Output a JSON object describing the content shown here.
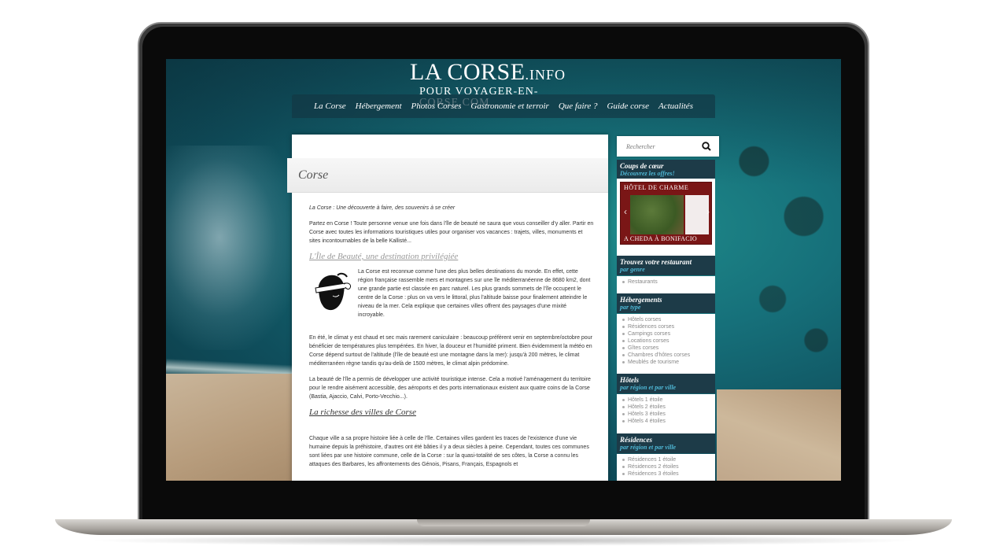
{
  "site": {
    "logo_title": "LA CORSE",
    "logo_suffix": ".INFO",
    "logo_subtitle": "POUR VOYAGER-EN-CORSE.COM"
  },
  "nav": {
    "items": [
      "La Corse",
      "Hébergement",
      "Photos Corses",
      "Gastronomie et terroir",
      "Que faire ?",
      "Guide corse",
      "Actualités"
    ]
  },
  "page": {
    "title": "Corse",
    "tagline": "La Corse : Une découverte à faire, des souvenirs à se créer",
    "intro": "Partez en Corse ! Toute personne venue une fois dans l'île de beauté ne saura que vous conseiller d'y aller. Partir en Corse avec toutes les informations touristiques utiles pour organiser vos vacances : trajets, villes, monuments et sites incontournables de la belle Kallisté...",
    "section1_heading": "L'Île de Beauté, une destination privilégiée",
    "section1_p1": "La Corse est reconnue comme l'une des plus belles destinations du monde. En effet, cette région française rassemble mers et montagnes sur une île méditerranéenne de 8680 km2, dont une grande partie est classée en parc naturel. Les plus grands sommets de l'île occupent le centre de la Corse : plus on va vers le littoral, plus l'altitude baisse pour finalement atteindre le niveau de la mer. Cela explique que certaines villes offrent des paysages d'une mixité incroyable.",
    "section1_p2": "En été, le climat y est chaud et sec mais rarement caniculaire : beaucoup préfèrent venir en septembre/octobre pour bénéficier de températures plus tempérées. En hiver, la douceur et l'humidité priment. Bien évidemment la météo en Corse dépend surtout de l'altitude (l'île de beauté est une montagne dans la mer): jusqu'à 200 mètres, le climat méditerranéen règne tandis qu'au-delà de 1500 mètres, le climat alpin prédomine.",
    "section1_p3": "La beauté de l'île a permis de développer une activité touristique intense. Cela a motivé l'aménagement du territoire pour le rendre aisément accessible, des aéroports et des ports internationaux existent aux quatre coins de la Corse (Bastia, Ajaccio, Calvi, Porto-Vecchio...).",
    "section2_heading": "La richesse des villes de Corse",
    "section2_p1": "Chaque ville a sa propre histoire liée à celle de l'île. Certaines villes gardent les traces de l'existence d'une vie humaine depuis la préhistoire, d'autres ont été bâties il y a deux siècles à peine. Cependant, toutes ces communes sont liées par une histoire commune, celle de la Corse : sur la quasi-totalité de ses côtes, la Corse a connu les attaques des Barbares, les affrontements des Génois, Pisans, Français, Espagnols et"
  },
  "sidebar": {
    "search_placeholder": "Rechercher",
    "coups_title": "Coups de cœur",
    "coups_sub": "Découvrez les offres!",
    "promo_top": "HÔTEL DE CHARME",
    "promo_bottom": "A CHEDA À BONIFACIO",
    "resto_title": "Trouvez votre restaurant",
    "resto_sub": "par genre",
    "resto_items": [
      "Restaurants"
    ],
    "heberg_title": "Hébergements",
    "heberg_sub": "par type",
    "heberg_items": [
      "Hôtels corses",
      "Résidences corses",
      "Campings corses",
      "Locations corses",
      "Gîtes corses",
      "Chambres d'hôtes corses",
      "Meublés de tourisme"
    ],
    "hotels_title": "Hôtels",
    "hotels_sub": "par région et par ville",
    "hotels_items": [
      "Hôtels 1 étoile",
      "Hôtels 2 étoiles",
      "Hôtels 3 étoiles",
      "Hôtels 4 étoiles"
    ],
    "res_title": "Résidences",
    "res_sub": "par région et par ville",
    "res_items": [
      "Résidences 1 étoile",
      "Résidences 2 étoiles",
      "Résidences 3 étoiles"
    ]
  },
  "colors": {
    "sidebar_head": "#1d3b48",
    "sidebar_sub": "#4fb8d6",
    "promo_red": "#7a1616"
  }
}
